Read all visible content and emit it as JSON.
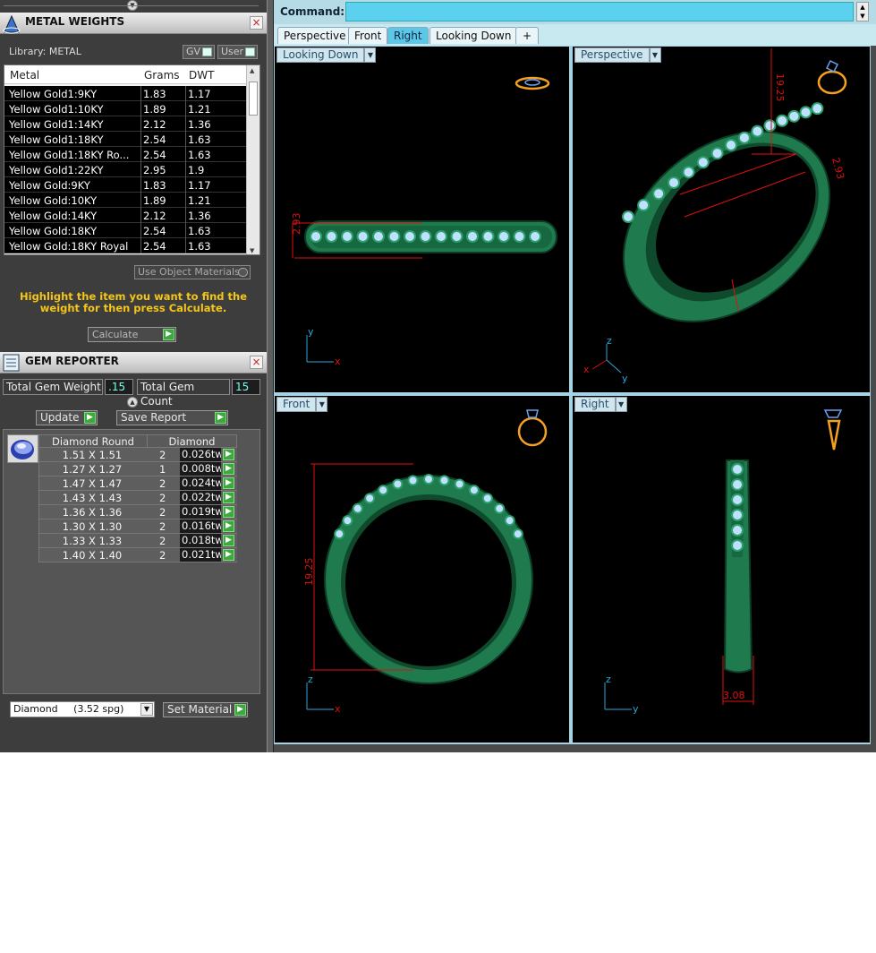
{
  "metal_weights": {
    "title": "METAL WEIGHTS",
    "library_label": "Library: METAL",
    "gv_label": "GV",
    "user_label": "User",
    "columns": [
      "Metal",
      "Grams",
      "DWT"
    ],
    "rows": [
      {
        "metal": "Yellow Gold1:9KY",
        "grams": "1.83",
        "dwt": "1.17"
      },
      {
        "metal": "Yellow Gold1:10KY",
        "grams": "1.89",
        "dwt": "1.21"
      },
      {
        "metal": "Yellow Gold1:14KY",
        "grams": "2.12",
        "dwt": "1.36"
      },
      {
        "metal": "Yellow Gold1:18KY",
        "grams": "2.54",
        "dwt": "1.63"
      },
      {
        "metal": "Yellow Gold1:18KY Ro...",
        "grams": "2.54",
        "dwt": "1.63"
      },
      {
        "metal": "Yellow Gold1:22KY",
        "grams": "2.95",
        "dwt": "1.9"
      },
      {
        "metal": "Yellow Gold:9KY",
        "grams": "1.83",
        "dwt": "1.17"
      },
      {
        "metal": "Yellow Gold:10KY",
        "grams": "1.89",
        "dwt": "1.21"
      },
      {
        "metal": "Yellow Gold:14KY",
        "grams": "2.12",
        "dwt": "1.36"
      },
      {
        "metal": "Yellow Gold:18KY",
        "grams": "2.54",
        "dwt": "1.63"
      },
      {
        "metal": "Yellow Gold:18KY Royal",
        "grams": "2.54",
        "dwt": "1.63"
      }
    ],
    "use_object_materials": "Use Object Materials",
    "hint": "Highlight the item you want to find the weight for then press Calculate.",
    "calculate": "Calculate"
  },
  "gem_reporter": {
    "title": "GEM REPORTER",
    "total_weight_label": "Total Gem Weight",
    "total_weight_value": ".15",
    "total_count_label": "Total Gem Count",
    "total_count_value": "15",
    "update": "Update",
    "save_report": "Save Report",
    "columns": [
      "Diamond Round",
      "Diamond"
    ],
    "rows": [
      {
        "size": "1.51 X 1.51",
        "count": "2",
        "weight": "0.026tw"
      },
      {
        "size": "1.27 X 1.27",
        "count": "1",
        "weight": "0.008tw"
      },
      {
        "size": "1.47 X 1.47",
        "count": "2",
        "weight": "0.024tw"
      },
      {
        "size": "1.43 X 1.43",
        "count": "2",
        "weight": "0.022tw"
      },
      {
        "size": "1.36 X 1.36",
        "count": "2",
        "weight": "0.019tw"
      },
      {
        "size": "1.30 X 1.30",
        "count": "2",
        "weight": "0.016tw"
      },
      {
        "size": "1.33 X 1.33",
        "count": "2",
        "weight": "0.018tw"
      },
      {
        "size": "1.40 X 1.40",
        "count": "2",
        "weight": "0.021tw"
      }
    ],
    "material_select": "Diamond     (3.52 spg)",
    "set_material": "Set Material"
  },
  "command": {
    "label": "Command:",
    "value": ""
  },
  "tabs": [
    "Perspective",
    "Front",
    "Right",
    "Looking Down",
    "+"
  ],
  "active_tab": "Right",
  "viewports": {
    "top_left": {
      "label": "Looking Down",
      "dimension": "2.93",
      "axis_v": "y",
      "axis_h": "x"
    },
    "top_right": {
      "label": "Perspective",
      "dimension_1": "19.25",
      "dimension_2": "2.93",
      "axis_z": "z",
      "axis_x": "x",
      "axis_y": "y"
    },
    "bottom_left": {
      "label": "Front",
      "dimension": "19.25",
      "axis_v": "z",
      "axis_h": "x"
    },
    "bottom_right": {
      "label": "Right",
      "dimension": "3.08",
      "axis_v": "z",
      "axis_h": "y"
    }
  },
  "colors": {
    "ring_green": "#1f7a4e",
    "ring_dark": "#0f4a2c",
    "gem": "#bfe0ff",
    "dim_red": "#e01010",
    "axis_blue": "#2aa7d8",
    "hint_yellow": "#f5c518"
  }
}
